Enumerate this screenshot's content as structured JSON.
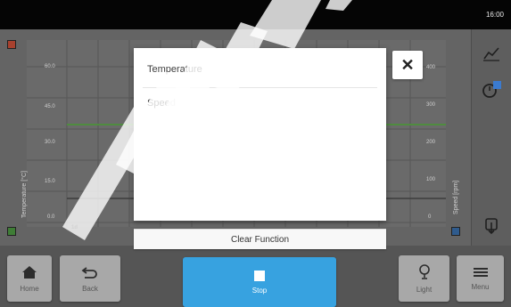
{
  "status": {
    "time": "16:00"
  },
  "chart": {
    "y_left_title": "Temperature [°C]",
    "y_right_title": "Speed [rpm]",
    "y_left_ticks": [
      "60.0",
      "45.0",
      "30.0",
      "15.0",
      "0.0"
    ],
    "y_right_ticks": [
      "400",
      "300",
      "200",
      "100",
      "0"
    ],
    "x_first_tick": "1d"
  },
  "dialog": {
    "options": [
      "Temperature",
      "Speed"
    ],
    "clear_label": "Clear Function",
    "close_symbol": "✕"
  },
  "toolbar": {
    "home_label": "Home",
    "back_label": "Back",
    "stop_label": "Stop",
    "light_label": "Light",
    "menu_label": "Menu"
  },
  "icons": {
    "home": "home-icon",
    "back": "back-arrow-icon",
    "stop": "stop-square-icon",
    "light": "lightbulb-icon",
    "menu": "hamburger-menu-icon",
    "chart": "line-chart-icon",
    "timer": "timer-icon",
    "export": "export-icon"
  },
  "colors": {
    "stop_button": "#37a2e0",
    "temperature_line": "#5aa84a",
    "temperature_marker": "#d1462f",
    "speed_marker": "#2f7bd1"
  }
}
